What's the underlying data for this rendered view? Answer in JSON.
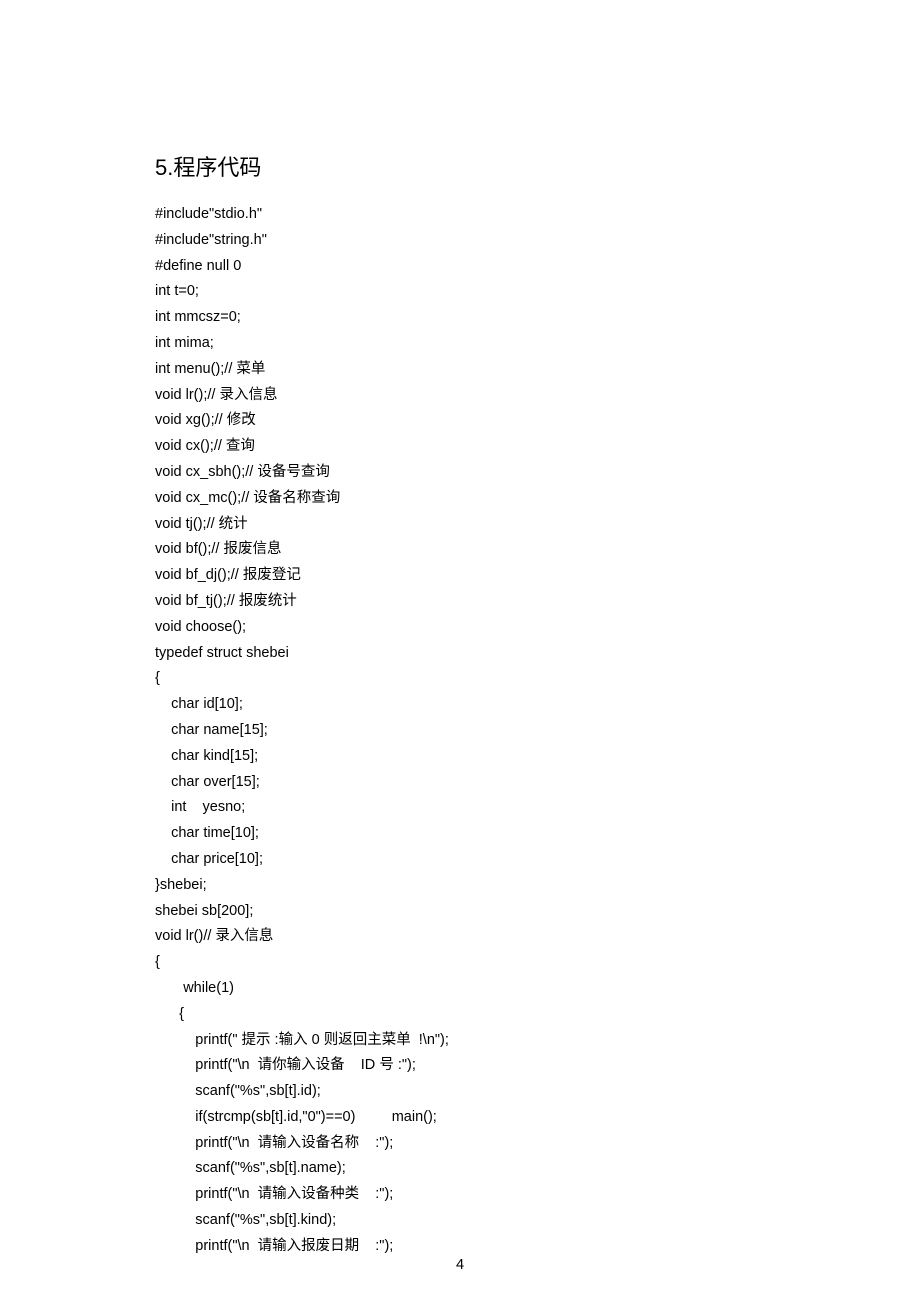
{
  "heading_num": "5.",
  "heading_text": "程序代码",
  "lines": [
    "#include\"stdio.h\"",
    "#include\"string.h\"",
    "#define null 0",
    "int t=0;",
    "int mmcsz=0;",
    "int mima;",
    "int menu();// 菜单",
    "void lr();// 录入信息",
    "void xg();// 修改",
    "void cx();// 查询",
    "void cx_sbh();// 设备号查询",
    "void cx_mc();// 设备名称查询",
    "void tj();// 统计",
    "void bf();// 报废信息",
    "void bf_dj();// 报废登记",
    "void bf_tj();// 报废统计",
    "void choose();",
    "typedef struct shebei",
    "{",
    "    char id[10];",
    "    char name[15];",
    "    char kind[15];",
    "    char over[15];",
    "    int    yesno;",
    "    char time[10];",
    "    char price[10];",
    "}shebei;",
    "shebei sb[200];",
    "void lr()// 录入信息",
    "{",
    "       while(1)",
    "      {",
    "          printf(\" 提示 :输入 0 则返回主菜单  !\\n\");",
    "          printf(\"\\n  请你输入设备    ID 号 :\");",
    "          scanf(\"%s\",sb[t].id);",
    "          if(strcmp(sb[t].id,\"0\")==0)         main();",
    "          printf(\"\\n  请输入设备名称    :\");",
    "          scanf(\"%s\",sb[t].name);",
    "          printf(\"\\n  请输入设备种类    :\");",
    "          scanf(\"%s\",sb[t].kind);",
    "          printf(\"\\n  请输入报废日期    :\");"
  ],
  "page_number": "4"
}
